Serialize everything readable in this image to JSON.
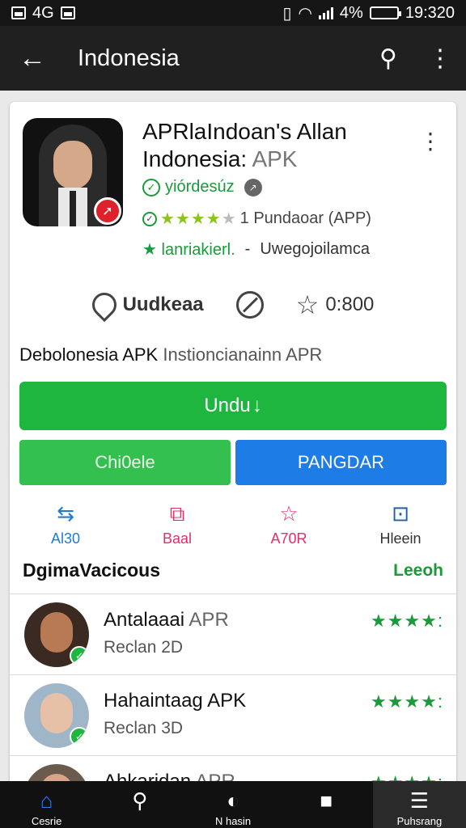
{
  "status_bar": {
    "left_text": "4G",
    "battery_text": "4%",
    "time": "19:320"
  },
  "app_bar": {
    "title": "Indonesia"
  },
  "app": {
    "title": "APRlaIndoan's Allan",
    "title2": "Indonesia:",
    "title2_suffix": "APK",
    "developer": "yiórdesúz",
    "rating_stars": "★★★★",
    "rating_off": "★",
    "rating_text": "1 Pundaoar (APP)",
    "category": "lanriakierl.",
    "category_sep": "-",
    "category_extra": "Uwegojoilamca",
    "meta": {
      "location": "Uudkeaa",
      "rating_value": "0:800"
    },
    "description": "Debolonesia APK",
    "description_dim": "Instioncianainn APR",
    "download_label": "Undu",
    "check_label": "Chi0ele",
    "install_label": "PANGDAR",
    "actions": [
      {
        "label": "Al30",
        "color": "#1f7ccf",
        "icon": "⇆"
      },
      {
        "label": "Baal",
        "color": "#e0306a",
        "icon": "⧉"
      },
      {
        "label": "A70R",
        "color": "#e0306a",
        "icon": "☆"
      },
      {
        "label": "Hleein",
        "color": "#1f5fae",
        "icon": "⊡"
      }
    ]
  },
  "similar": {
    "heading": "DgimaVacicous",
    "more_label": "Leeoh",
    "items": [
      {
        "title": "Antalaaai",
        "title_dim": "APR",
        "sub": "Reclan 2D",
        "stars": "★★★★:",
        "skin": "#b77a55",
        "bg": "#3a2a22"
      },
      {
        "title": "Hahaintaag APK",
        "title_dim": "",
        "sub": "Reclan 3D",
        "stars": "★★★★:",
        "skin": "#e6c1a8",
        "bg": "#9fb6c9"
      },
      {
        "title": "Ahkaridan",
        "title_dim": "APR",
        "sub": "",
        "stars": "★★★★:",
        "skin": "#d8a58a",
        "bg": "#6b5a4e"
      }
    ]
  },
  "nav": {
    "items": [
      {
        "label": "Cesrie",
        "icon": "⌂"
      },
      {
        "label": "",
        "icon": "⚲"
      },
      {
        "label": "N hasin",
        "icon": "◐"
      },
      {
        "label": "",
        "icon": "■"
      },
      {
        "label": "Puhsrang",
        "icon": "☰"
      }
    ]
  }
}
